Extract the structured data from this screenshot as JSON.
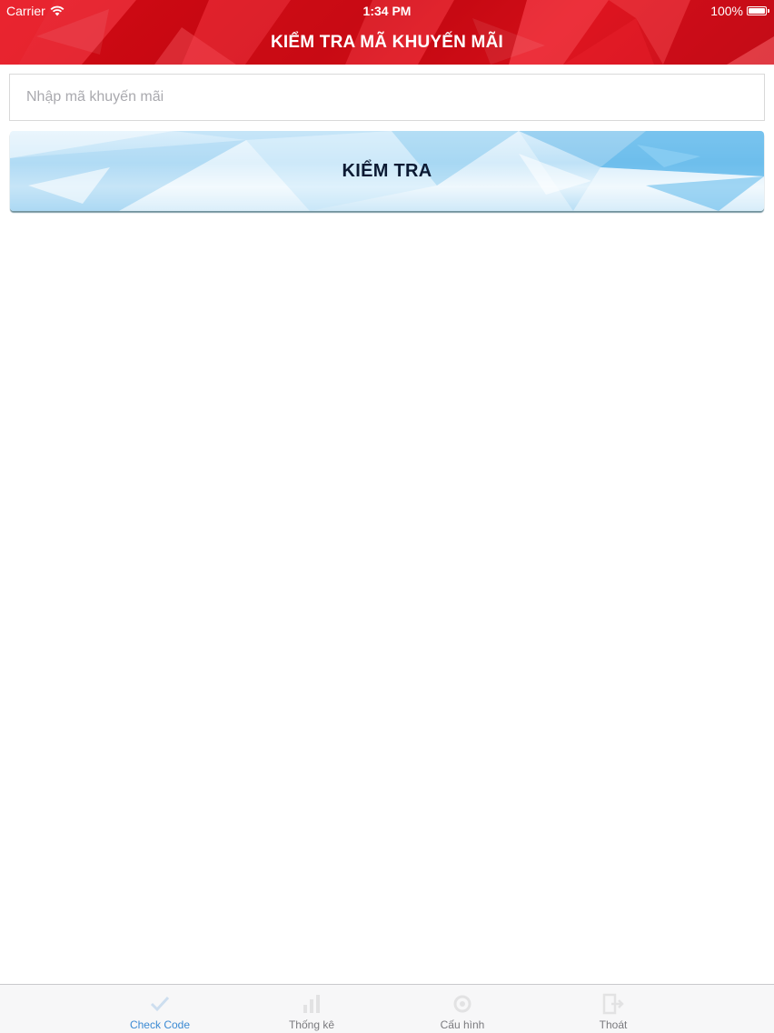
{
  "status_bar": {
    "carrier": "Carrier",
    "time": "1:34 PM",
    "battery": "100%"
  },
  "header": {
    "title": "KIỂM TRA MÃ KHUYẾN MÃI"
  },
  "promo_input": {
    "value": "",
    "placeholder": "Nhập mã khuyến mãi"
  },
  "check_button": {
    "label": "KIỂM TRA"
  },
  "tab_bar": {
    "active_index": 0,
    "tabs": [
      {
        "label": "Check Code",
        "icon": "check-icon"
      },
      {
        "label": "Thống kê",
        "icon": "chart-icon"
      },
      {
        "label": "Cấu hình",
        "icon": "gear-icon"
      },
      {
        "label": "Thoát",
        "icon": "logout-icon"
      }
    ]
  },
  "colors": {
    "header_red": "#d9101a",
    "active_tab": "#3b8ad3",
    "inactive_tab": "#7a7a7e",
    "button_text": "#0c1a33"
  }
}
